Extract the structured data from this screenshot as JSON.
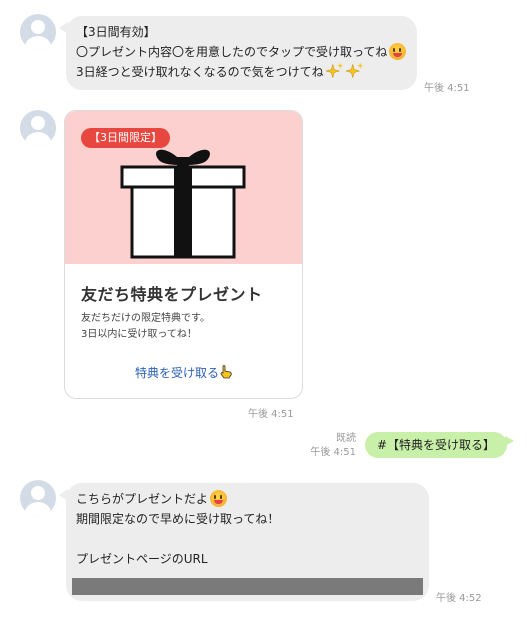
{
  "messages": {
    "m1": {
      "lines": [
        "【3日間有効】",
        "〇プレゼント内容〇を用意したのでタップで受け取ってね",
        "3日経つと受け取れなくなるので気をつけてね"
      ],
      "time": "午後 4:51"
    },
    "card": {
      "badge": "【3日間限定】",
      "title": "友だち特典をプレゼント",
      "desc": [
        "友だちだけの限定特典です。",
        "3日以内に受け取ってね！"
      ],
      "link": "特典を受け取る",
      "time": "午後 4:51"
    },
    "reply": {
      "read_label": "既読",
      "time": "午後 4:51",
      "text": "#【特典を受け取る】"
    },
    "m3": {
      "lines": [
        "こちらがプレゼントだよ",
        "期間限定なので早めに受け取ってね！",
        "",
        "プレゼントページのURL"
      ],
      "time": "午後 4:52"
    }
  },
  "icons": {
    "avatar": "default-user-avatar",
    "smile": "grinning-face-emoji",
    "sparkles": "sparkles-emoji",
    "gift": "gift-box",
    "pointer": "pointing-hand-emoji"
  },
  "colors": {
    "bubble": "#ededed",
    "reply_bubble": "#c8f0a8",
    "card_image_bg": "#fdd0d0",
    "badge": "#e8473f",
    "link": "#2a5fb8"
  }
}
